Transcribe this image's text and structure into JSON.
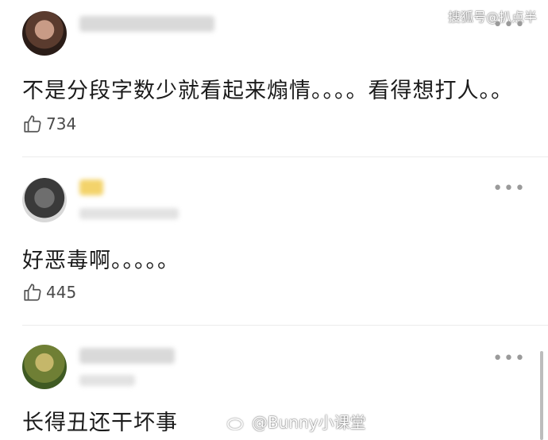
{
  "watermark": {
    "source": "搜狐号@扒点半",
    "account": "@Bunny小课堂"
  },
  "comments": [
    {
      "text": "不是分段字数少就看起来煽情。。。。看得想打人。。",
      "likes": "734",
      "more_icon": "ellipsis-icon"
    },
    {
      "text": "好恶毒啊。。。。。",
      "likes": "445",
      "more_icon": "ellipsis-icon"
    },
    {
      "text": "长得丑还干坏事",
      "more_icon": "ellipsis-icon"
    }
  ]
}
